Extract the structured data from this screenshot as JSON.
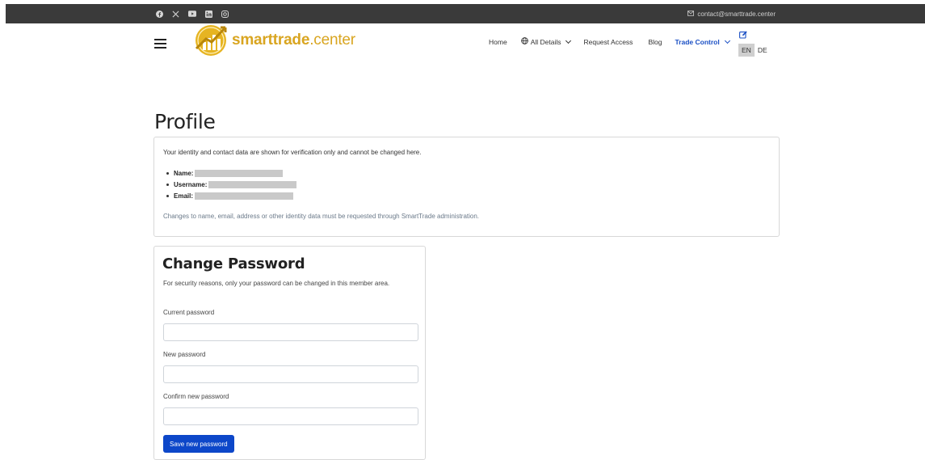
{
  "topbar": {
    "social_icons": [
      "facebook-icon",
      "x-icon",
      "youtube-icon",
      "linkedin-icon",
      "instagram-icon"
    ],
    "contact_email": "contact@smarttrade.center"
  },
  "navbar": {
    "brand": {
      "name": "smarttrade",
      "tld": ".center"
    },
    "links": {
      "home": "Home",
      "all_details": "All Details",
      "request_access": "Request Access",
      "blog": "Blog",
      "trade_control": "Trade Control"
    },
    "languages": [
      "EN",
      "DE"
    ],
    "active_language": "EN"
  },
  "profile": {
    "title": "Profile",
    "intro": "Your identity and contact data are shown for verification only and cannot be changed here.",
    "fields": {
      "name_label": "Name:",
      "username_label": "Username:",
      "email_label": "Email:"
    },
    "note": "Changes to name, email, address or other identity data must be requested through SmartTrade administration."
  },
  "change_password": {
    "title": "Change Password",
    "hint": "For security reasons, only your password can be changed in this member area.",
    "current_label": "Current password",
    "current_value": "",
    "new_label": "New password",
    "new_value": "",
    "confirm_label": "Confirm new password",
    "confirm_value": "",
    "save_label": "Save new password"
  },
  "colors": {
    "accent_blue": "#0d47c9",
    "brand_gold": "#d9a520",
    "topbar_bg": "#3a3a3a"
  }
}
